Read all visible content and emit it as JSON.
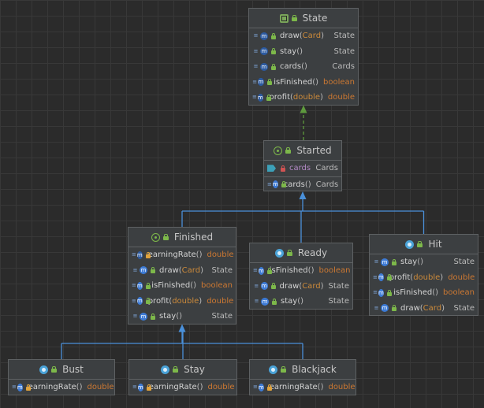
{
  "colors": {
    "background": "#2b2b2b",
    "node_bg": "#3c3f41",
    "node_border": "#5e6163",
    "inheritance_edge": "#4a90d9",
    "realization_edge": "#5e9a3e",
    "primitive_type": "#cc7832",
    "field_name": "#b389c5"
  },
  "nodes": [
    {
      "id": "state",
      "name": "State",
      "kind": "interface",
      "members": [
        {
          "kind": "method",
          "abstract": true,
          "visibility": "public",
          "name": "draw",
          "params": "Card",
          "type": "State"
        },
        {
          "kind": "method",
          "abstract": true,
          "visibility": "public",
          "name": "stay",
          "params": "",
          "type": "State"
        },
        {
          "kind": "method",
          "abstract": true,
          "visibility": "public",
          "name": "cards",
          "params": "",
          "type": "Cards"
        },
        {
          "kind": "method",
          "abstract": true,
          "visibility": "public",
          "name": "isFinished",
          "params": "",
          "type": "boolean"
        },
        {
          "kind": "method",
          "abstract": true,
          "visibility": "public",
          "name": "profit",
          "params": "double",
          "type": "double"
        }
      ]
    },
    {
      "id": "started",
      "name": "Started",
      "kind": "abstract-class",
      "members": [
        {
          "kind": "field",
          "visibility": "private",
          "name": "cards",
          "params": null,
          "type": "Cards"
        },
        {
          "kind": "method",
          "abstract": false,
          "visibility": "public",
          "name": "cards",
          "params": "",
          "type": "Cards"
        }
      ]
    },
    {
      "id": "finished",
      "name": "Finished",
      "kind": "abstract-class",
      "members": [
        {
          "kind": "method",
          "abstract": true,
          "visibility": "protected",
          "name": "earningRate",
          "params": "",
          "type": "double"
        },
        {
          "kind": "method",
          "abstract": false,
          "visibility": "public",
          "name": "draw",
          "params": "Card",
          "type": "State"
        },
        {
          "kind": "method",
          "abstract": false,
          "visibility": "public",
          "name": "isFinished",
          "params": "",
          "type": "boolean"
        },
        {
          "kind": "method",
          "abstract": false,
          "visibility": "public",
          "name": "profit",
          "params": "double",
          "type": "double"
        },
        {
          "kind": "method",
          "abstract": false,
          "visibility": "public",
          "name": "stay",
          "params": "",
          "type": "State"
        }
      ]
    },
    {
      "id": "ready",
      "name": "Ready",
      "kind": "class",
      "members": [
        {
          "kind": "method",
          "abstract": false,
          "visibility": "public",
          "name": "isFinished",
          "params": "",
          "type": "boolean"
        },
        {
          "kind": "method",
          "abstract": false,
          "visibility": "public",
          "name": "draw",
          "params": "Card",
          "type": "State"
        },
        {
          "kind": "method",
          "abstract": false,
          "visibility": "public",
          "name": "stay",
          "params": "",
          "type": "State"
        }
      ]
    },
    {
      "id": "hit",
      "name": "Hit",
      "kind": "class",
      "members": [
        {
          "kind": "method",
          "abstract": false,
          "visibility": "public",
          "name": "stay",
          "params": "",
          "type": "State"
        },
        {
          "kind": "method",
          "abstract": false,
          "visibility": "public",
          "name": "profit",
          "params": "double",
          "type": "double"
        },
        {
          "kind": "method",
          "abstract": false,
          "visibility": "public",
          "name": "isFinished",
          "params": "",
          "type": "boolean"
        },
        {
          "kind": "method",
          "abstract": false,
          "visibility": "public",
          "name": "draw",
          "params": "Card",
          "type": "State"
        }
      ]
    },
    {
      "id": "bust",
      "name": "Bust",
      "kind": "class",
      "members": [
        {
          "kind": "method",
          "abstract": false,
          "visibility": "protected",
          "name": "earningRate",
          "params": "",
          "type": "double"
        }
      ]
    },
    {
      "id": "stay",
      "name": "Stay",
      "kind": "class",
      "members": [
        {
          "kind": "method",
          "abstract": false,
          "visibility": "protected",
          "name": "earningRate",
          "params": "",
          "type": "double"
        }
      ]
    },
    {
      "id": "blackjack",
      "name": "Blackjack",
      "kind": "class",
      "members": [
        {
          "kind": "method",
          "abstract": false,
          "visibility": "protected",
          "name": "earningRate",
          "params": "",
          "type": "double"
        }
      ]
    }
  ],
  "edges": [
    {
      "from": "started",
      "to": "state",
      "kind": "realization"
    },
    {
      "from": "finished",
      "to": "started",
      "kind": "inheritance"
    },
    {
      "from": "ready",
      "to": "started",
      "kind": "inheritance"
    },
    {
      "from": "hit",
      "to": "started",
      "kind": "inheritance"
    },
    {
      "from": "bust",
      "to": "finished",
      "kind": "inheritance"
    },
    {
      "from": "stay",
      "to": "finished",
      "kind": "inheritance"
    },
    {
      "from": "blackjack",
      "to": "finished",
      "kind": "inheritance"
    }
  ]
}
